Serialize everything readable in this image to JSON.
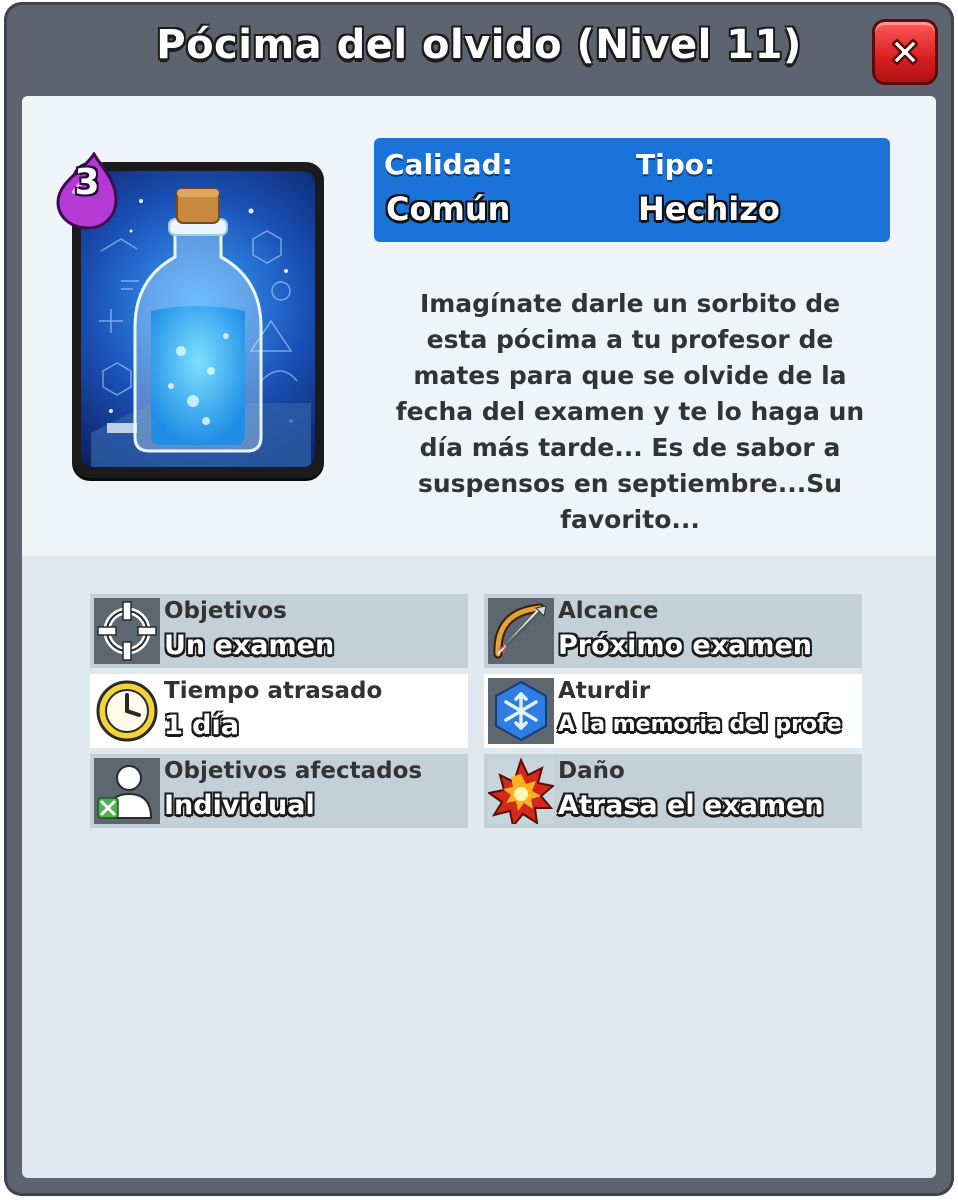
{
  "header": {
    "title": "Pócima del olvido (Nivel 11)"
  },
  "card": {
    "elixir_cost": "3",
    "art": "potion-bottle-illustration"
  },
  "info": {
    "quality_label": "Calidad:",
    "quality_value": "Común",
    "type_label": "Tipo:",
    "type_value": "Hechizo",
    "color": "#1a73d9"
  },
  "description": {
    "lines": [
      "Imagínate darle un sorbito de",
      "esta pócima a tu profesor de",
      "mates para que se olvide de la",
      "fecha del examen y te lo haga un",
      "día más tarde... Es de sabor a",
      "suspensos en septiembre...Su",
      "favorito..."
    ]
  },
  "stats": [
    {
      "label": "Objetivos",
      "value": "Un examen",
      "icon": "target-icon"
    },
    {
      "label": "Alcance",
      "value": "Próximo examen",
      "icon": "bow-icon"
    },
    {
      "label": "Tiempo atrasado",
      "value": "1 día",
      "icon": "clock-icon"
    },
    {
      "label": "Aturdir",
      "value": "A la memoria del profe",
      "icon": "snowflake-icon"
    },
    {
      "label": "Objetivos afectados",
      "value": "Individual",
      "icon": "single-target-icon"
    },
    {
      "label": "Daño",
      "value": "Atrasa el examen",
      "icon": "explosion-icon"
    }
  ]
}
